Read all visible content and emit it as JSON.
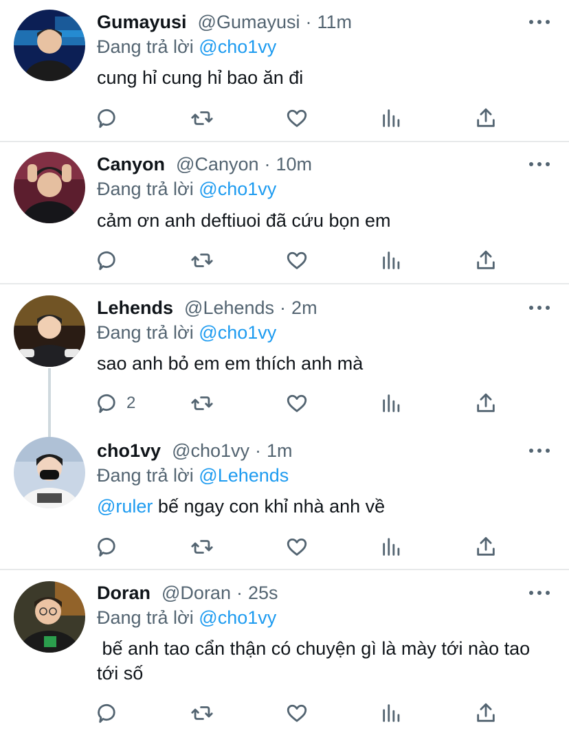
{
  "tweets": [
    {
      "name": "Gumayusi",
      "handle": "@Gumayusi",
      "time": "11m",
      "reply_prefix": "Đang trả lời",
      "reply_to": "@cho1vy",
      "body_mention": "",
      "body": "cung hỉ cung hỉ bao ăn đi",
      "reply_count": "",
      "avatar_colors": {
        "bg": "#0c1f55",
        "accent": "#2fb3ff",
        "skin": "#e8c2a2",
        "shirt": "#1b1b1b"
      }
    },
    {
      "name": "Canyon",
      "handle": "@Canyon",
      "time": "10m",
      "reply_prefix": "Đang trả lời",
      "reply_to": "@cho1vy",
      "body_mention": "",
      "body": "cảm ơn anh deftiuoi đã cứu bọn em",
      "reply_count": "",
      "avatar_colors": {
        "bg": "#5c1e2e",
        "accent": "#a7425a",
        "skin": "#e5bfa0",
        "shirt": "#16161a"
      }
    },
    {
      "name": "Lehends",
      "handle": "@Lehends",
      "time": "2m",
      "reply_prefix": "Đang trả lời",
      "reply_to": "@cho1vy",
      "body_mention": "",
      "body": "sao anh bỏ em em thích anh mà",
      "reply_count": "2",
      "avatar_colors": {
        "bg": "#2a1c14",
        "accent": "#c89a3a",
        "skin": "#f0cfb3",
        "shirt": "#202024"
      }
    },
    {
      "name": "cho1vy",
      "handle": "@cho1vy",
      "time": "1m",
      "reply_prefix": "Đang trả lời",
      "reply_to": "@Lehends",
      "body_mention": "@ruler",
      "body": " bế ngay con khỉ nhà anh về",
      "reply_count": "",
      "avatar_colors": {
        "bg": "#c9d6e6",
        "accent": "#9fb3cc",
        "skin": "#f1d4bf",
        "shirt": "#f4f4f4"
      }
    },
    {
      "name": "Doran",
      "handle": "@Doran",
      "time": "25s",
      "reply_prefix": "Đang trả lời",
      "reply_to": "@cho1vy",
      "body_mention": "",
      "body": " bế anh tao cẩn thận có chuyện gì là mày tới nào tao tới số",
      "reply_count": "",
      "avatar_colors": {
        "bg": "#3c3a2a",
        "accent": "#e88b2a",
        "skin": "#ecc4a4",
        "shirt": "#1a1a1a"
      }
    }
  ],
  "icons": {
    "reply": "reply-icon",
    "retweet": "retweet-icon",
    "like": "heart-icon",
    "analytics": "analytics-icon",
    "share": "share-icon",
    "more": "more-icon"
  },
  "colors": {
    "text": "#0f1419",
    "secondary": "#536471",
    "link": "#1d9bf0",
    "divider": "#e7e9ea"
  }
}
